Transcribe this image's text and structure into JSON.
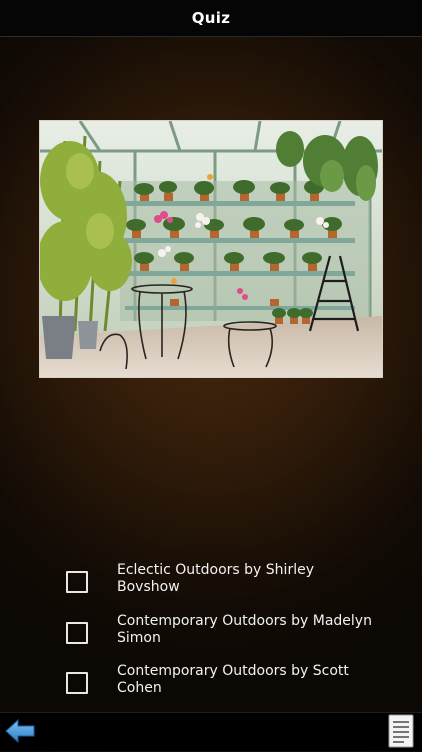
{
  "header": {
    "title": "Quiz"
  },
  "quiz": {
    "image_subject": "greenhouse-orchids-photo",
    "options": [
      {
        "label": "Eclectic Outdoors by Shirley Bovshow",
        "checked": false
      },
      {
        "label": "Contemporary Outdoors by Madelyn Simon",
        "checked": false
      },
      {
        "label": "Contemporary Outdoors by Scott Cohen",
        "checked": false
      }
    ]
  },
  "toolbar": {
    "back_icon": "back-arrow-icon",
    "notes_icon": "document-list-icon"
  },
  "colors": {
    "accent_blue": "#3d8fd8",
    "background_brown": "#3a2210"
  }
}
